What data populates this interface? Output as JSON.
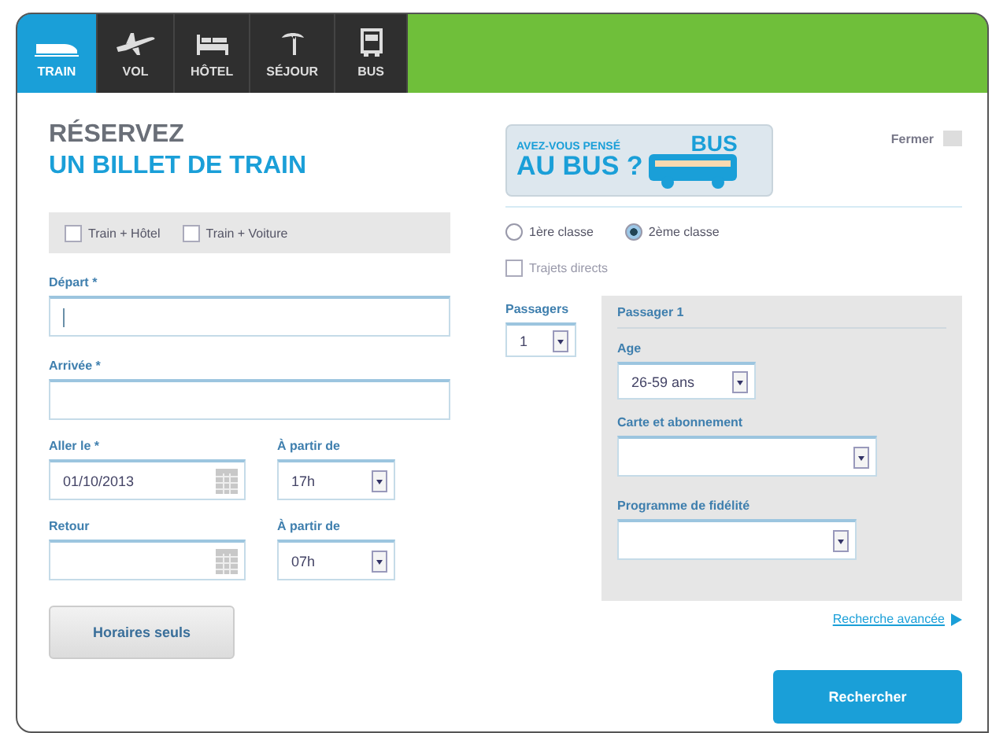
{
  "tabs": [
    {
      "label": "TRAIN",
      "selected": true
    },
    {
      "label": "VOL",
      "selected": false
    },
    {
      "label": "HÔTEL",
      "selected": false
    },
    {
      "label": "SÉJOUR",
      "selected": false
    },
    {
      "label": "BUS",
      "selected": false
    }
  ],
  "title": {
    "line_1": "RÉSERVEZ",
    "line_2": "UN BILLET DE TRAIN"
  },
  "banner": {
    "line_1": "AVEZ-VOUS PENSÉ",
    "line_2": "AU BUS ?",
    "badge": "BUS"
  },
  "close_label": "Fermer",
  "options": [
    {
      "label": "Train + Hôtel",
      "checked": false
    },
    {
      "label": "Train + Voiture",
      "checked": false
    }
  ],
  "classes": [
    {
      "label": "1ère classe",
      "selected": false
    },
    {
      "label": "2ème classe",
      "selected": true
    }
  ],
  "direct": {
    "label": "Trajets directs",
    "checked": false
  },
  "departure": {
    "label": "Départ *",
    "focused": true
  },
  "arrival": {
    "label": "Arrivée *"
  },
  "outbound": {
    "label": "Aller le *",
    "value": "01/10/2013",
    "time_label": "À partir de",
    "time": "17h"
  },
  "return": {
    "label": "Retour",
    "time_label": "À partir de",
    "time": "07h"
  },
  "passengers": {
    "label": "Passagers",
    "value": "1"
  },
  "passenger": {
    "title": "Passager 1",
    "age_label": "Age",
    "age": "26-59 ans",
    "card_label": "Carte et abonnement",
    "loyalty_label": "Programme de fidélité"
  },
  "advanced_link": "Recherche avancée",
  "buttons": {
    "timetable": "Horaires seuls",
    "search": "Rechercher"
  }
}
